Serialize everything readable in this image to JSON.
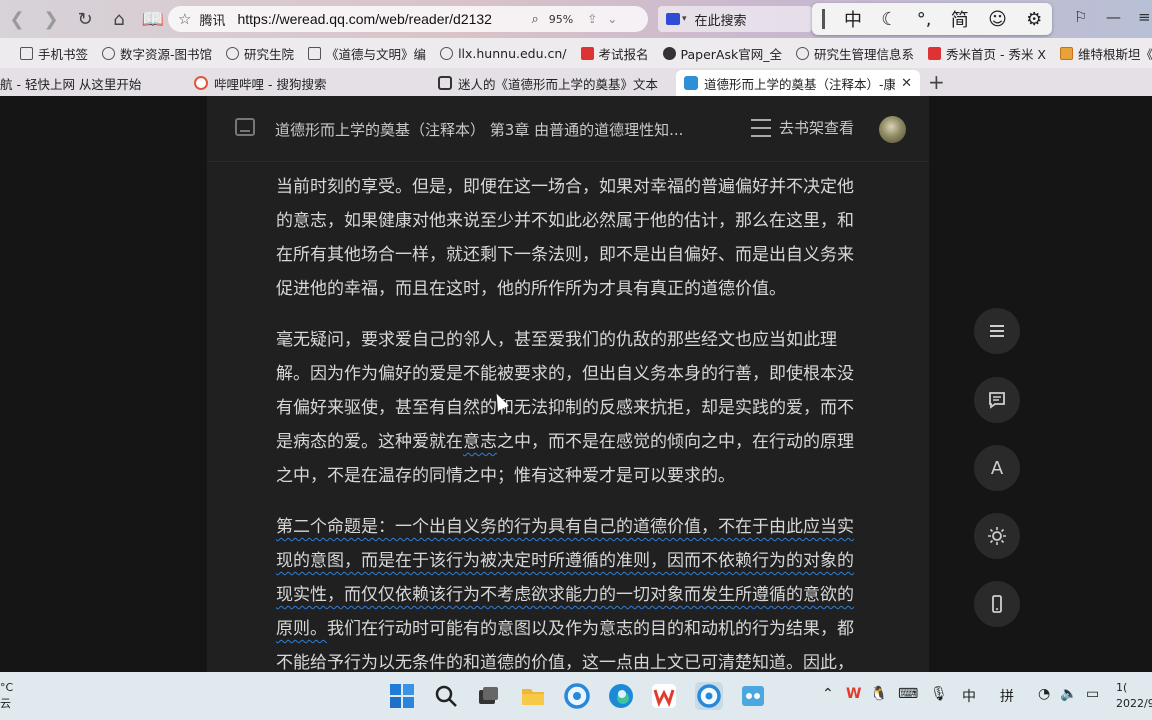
{
  "browser": {
    "nav": {
      "back": "❮",
      "forward": "❯",
      "refresh": "↻",
      "home": "⌂",
      "reader": "📖"
    },
    "address": {
      "site": "腾讯",
      "url": "https://weread.qq.com/web/reader/d2132",
      "zoom": "95%"
    },
    "search": {
      "label": "在此搜索"
    },
    "ime": {
      "sep": "|",
      "mode": "中",
      "moon": "☾",
      "punct": "°,",
      "simp": "简",
      "emoji": "☺",
      "gear": "⚙"
    },
    "bookmarks": [
      "手机书签",
      "数字资源-图书馆",
      "研究生院",
      "《道德与文明》编",
      "llx.hunnu.edu.cn/",
      "考试报名",
      "PaperAsk官网_全",
      "研究生管理信息系",
      "秀米首页 - 秀米 X",
      "维特根斯坦《逻辑"
    ],
    "tabs": [
      {
        "label": "航 - 轻快上网 从这里开始"
      },
      {
        "label": "哔哩哔哩 - 搜狗搜索"
      },
      {
        "label": "迷人的《道德形而上学的奠基》文本"
      },
      {
        "label": "道德形而上学的奠基（注释本）-康德"
      }
    ],
    "new_tab": "+"
  },
  "reader": {
    "header_title": "道德形而上学的奠基（注释本） 第3章 由普通的道德理性知...",
    "shelf_label": "去书架查看",
    "paragraphs": [
      "当前时刻的享受。但是，即便在这一场合，如果对幸福的普遍偏好并不决定他的意志，如果健康对他来说至少并不如此必然属于他的估计，那么在这里，和在所有其他场合一样，就还剩下一条法则，即不是出自偏好、而是出自义务来促进他的幸福，而且在这时，他的所作所为才具有真正的道德价值。",
      {
        "before": "毫无疑问，要求爱自己的邻人，甚至爱我们的仇敌的那些经文也应当如此理解。因为作为偏好的爱是不能被要求的，但出自义务本身的行善，即使根本没有偏好来驱使，甚至有自然的和无法抑制的反感来抗拒，却是实践的爱，而不是病态的爱。这种爱就在",
        "mark": "意志",
        "after": "之中，而不是在感觉的倾向之中，在行动的原理之中，不是在温存的同情之中；惟有这种爱才是可以要求的。"
      },
      {
        "underlined": "第二个命题是：一个出自义务的行为具有自己的道德价值，不在于由此应当实现的意图，而是在于该行为被决定时所遵循的准则，因而不依赖行为的对象的现实性，而仅仅依赖该行为不考虑欲求能力的一切对象而发生所遵循的意欲的原则。",
        "rest": "我们在行动时可能有的意图以及作为意志的目的和动机的行为结果，都不能给予行为以无条件的和道德的价值，这一点由上文已可清楚知道。因此，"
      }
    ],
    "side_buttons": [
      "toc-icon",
      "notes-icon",
      "font-icon",
      "brightness-icon",
      "phone-icon"
    ],
    "font_btn_label": "A"
  },
  "taskbar": {
    "weather_temp": "°C",
    "weather_desc": "云",
    "tray": {
      "chevron": "⌃",
      "ime_cn": "中",
      "ime_pin": "拼"
    },
    "clock_time": "1(",
    "clock_date": "2022/9"
  }
}
